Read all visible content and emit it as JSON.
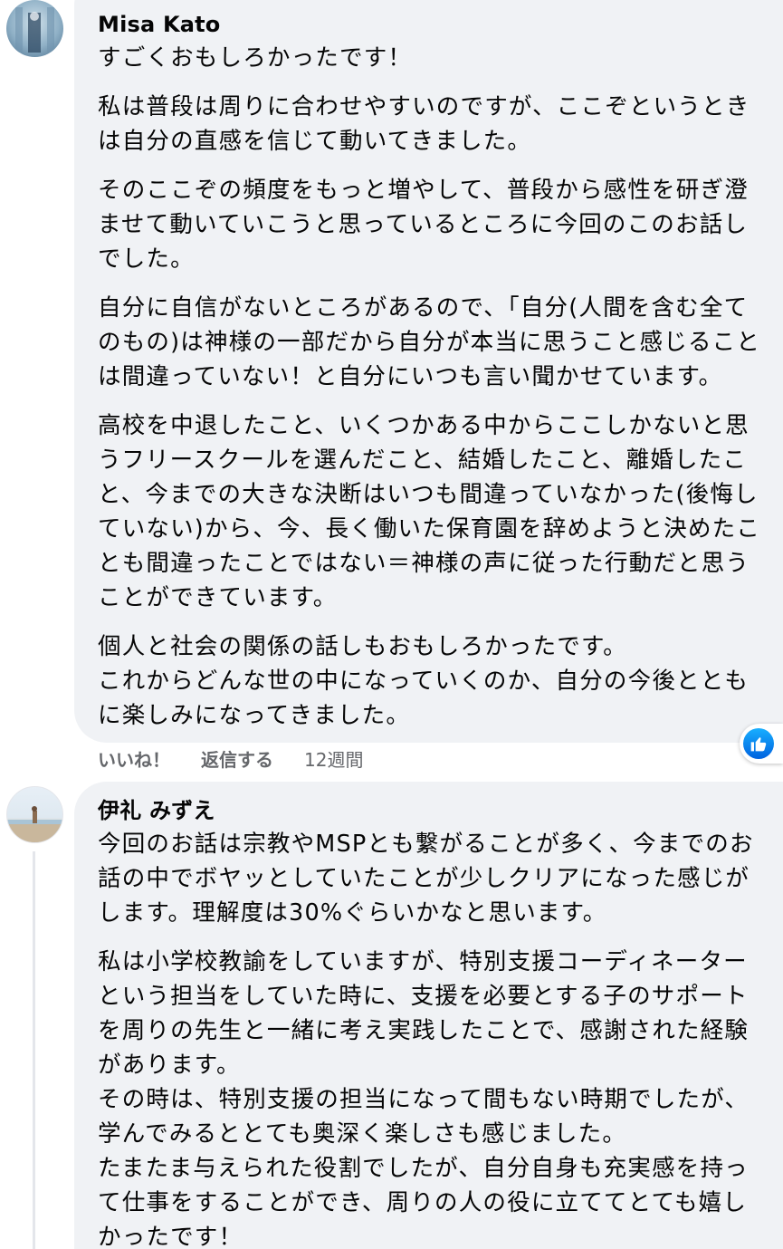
{
  "comments": [
    {
      "author": "Misa Kato",
      "paragraphs": [
        [
          "すごくおもしろかったです！"
        ],
        [
          "私は普段は周りに合わせやすいのですが、ここぞというとき",
          "は自分の直感を信じて動いてきました。"
        ],
        [
          "そのここぞの頻度をもっと増やして、普段から感性を研ぎ澄",
          "ませて動いていこうと思っているところに今回のこのお話し",
          "でした。"
        ],
        [
          "自分に自信がないところがあるので、「自分(人間を含む全て",
          "のもの)は神様の一部だから自分が本当に思うこと感じること",
          "は間違っていない！と自分にいつも言い聞かせています。"
        ],
        [
          "高校を中退したこと、いくつかある中からここしかないと思",
          "うフリースクールを選んだこと、結婚したこと、離婚したこ",
          "と、今までの大きな決断はいつも間違っていなかった(後悔し",
          "ていない)から、今、長く働いた保育園を辞めようと決めたこ",
          "とも間違ったことではない＝神様の声に従った行動だと思う",
          "ことができています。"
        ],
        [
          "個人と社会の関係の話しもおもしろかったです。",
          "これからどんな世の中になっていくのか、自分の今後ととも",
          "に楽しみになってきました。"
        ]
      ],
      "actions": {
        "like": "いいね！",
        "reply": "返信する",
        "time": "12週間"
      },
      "reaction_icon": "like-icon"
    },
    {
      "author": "伊礼 みずえ",
      "paragraphs": [
        [
          "今回のお話は宗教やMSPとも繋がることが多く、今までのお",
          "話の中でボヤッとしていたことが少しクリアになった感じが",
          "します。理解度は30%ぐらいかなと思います。"
        ],
        [
          "私は小学校教諭をしていますが、特別支援コーディネーター",
          "という担当をしていた時に、支援を必要とする子のサポート",
          "を周りの先生と一緒に考え実践したことで、感謝された経験",
          "があります。",
          "その時は、特別支援の担当になって間もない時期でしたが、",
          "学んでみるととても奥深く楽しさも感じました。",
          "たまたま与えられた役割でしたが、自分自身も充実感を持っ",
          "て仕事をすることができ、周りの人の役に立ててとても嬉し",
          "かったです！"
        ]
      ]
    }
  ],
  "colors": {
    "bubble": "#f0f2f5",
    "meta_text": "#65676b",
    "like_blue": "#1877f2"
  }
}
